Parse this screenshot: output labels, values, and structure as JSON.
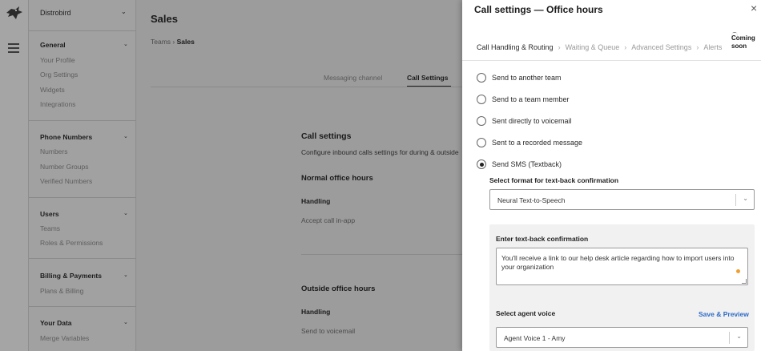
{
  "sidebar": {
    "workspace": "Distrobird",
    "sections": [
      {
        "title": "General",
        "items": [
          "Your Profile",
          "Org Settings",
          "Widgets",
          "Integrations"
        ]
      },
      {
        "title": "Phone Numbers",
        "items": [
          "Numbers",
          "Number Groups",
          "Verified Numbers"
        ]
      },
      {
        "title": "Users",
        "items": [
          "Teams",
          "Roles & Permissions"
        ]
      },
      {
        "title": "Billing & Payments",
        "items": [
          "Plans & Billing"
        ]
      },
      {
        "title": "Your Data",
        "items": [
          "Merge Variables"
        ]
      }
    ]
  },
  "main": {
    "title": "Sales",
    "breadcrumb": {
      "parent": "Teams",
      "separator": "›",
      "current": "Sales"
    },
    "tabs": [
      {
        "label": "Messaging channel"
      },
      {
        "label": "Call Settings"
      }
    ],
    "call_settings": {
      "heading": "Call settings",
      "description": "Configure inbound calls settings for during & outside",
      "normal": {
        "heading": "Normal office hours",
        "handling_label": "Handling",
        "handling_value": "Accept call in-app"
      },
      "outside": {
        "heading": "Outside office hours",
        "handling_label": "Handling",
        "handling_value": "Send to voicemail"
      }
    }
  },
  "panel": {
    "title": "Call settings — Office hours",
    "close": "×",
    "steps": [
      "Call Handling & Routing",
      "Waiting & Queue",
      "Advanced Settings",
      "Alerts"
    ],
    "step_sep": "›",
    "badge": "Coming soon",
    "options": [
      {
        "label": "Send to another team"
      },
      {
        "label": "Send to a team member"
      },
      {
        "label": "Sent directly to voicemail"
      },
      {
        "label": "Sent to a recorded message"
      },
      {
        "label": "Send SMS (Textback)"
      }
    ],
    "selected_option": "Send SMS (Textback)",
    "format": {
      "label": "Select format for text-back confirmation",
      "value": "Neural Text-to-Speech"
    },
    "textback": {
      "label": "Enter text-back confirmation",
      "value": "You'll receive a link to our help desk article regarding how to import users into your organization"
    },
    "voice": {
      "label": "Select agent voice",
      "save_preview": "Save & Preview",
      "value": "Agent Voice 1 - Amy"
    }
  },
  "colors": {
    "accent_link": "#2e6bc7",
    "overlay": "#9c9c9c",
    "indicator_dot": "#f0a030"
  }
}
